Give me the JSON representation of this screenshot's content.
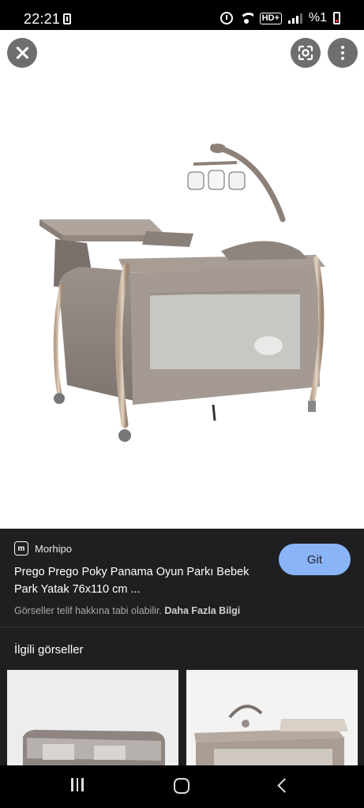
{
  "status_bar": {
    "time": "22:21",
    "network": "HD+",
    "battery_percent": "%1",
    "icons": [
      "battery-saver-icon",
      "alarm-icon",
      "wifi-icon",
      "hd-voice-icon",
      "signal-icon",
      "battery-icon"
    ]
  },
  "viewer": {
    "close_icon": "close-icon",
    "lens_icon": "google-lens-icon",
    "more_icon": "more-vert-icon"
  },
  "result": {
    "source": "Morhipo",
    "source_logo_text": "m",
    "title": "Prego Prego Poky Panama Oyun Parkı Bebek Park Yatak 76x110 cm ...",
    "copyright_text": "Görseller telif hakkına tabi olabilir.",
    "more_info": "Daha Fazla Bilgi",
    "go_button": "Git",
    "accent": "#8ab4f8"
  },
  "related": {
    "title": "İlgili görseller"
  },
  "navbar": {
    "icons": [
      "recents-icon",
      "home-icon",
      "back-icon"
    ]
  }
}
